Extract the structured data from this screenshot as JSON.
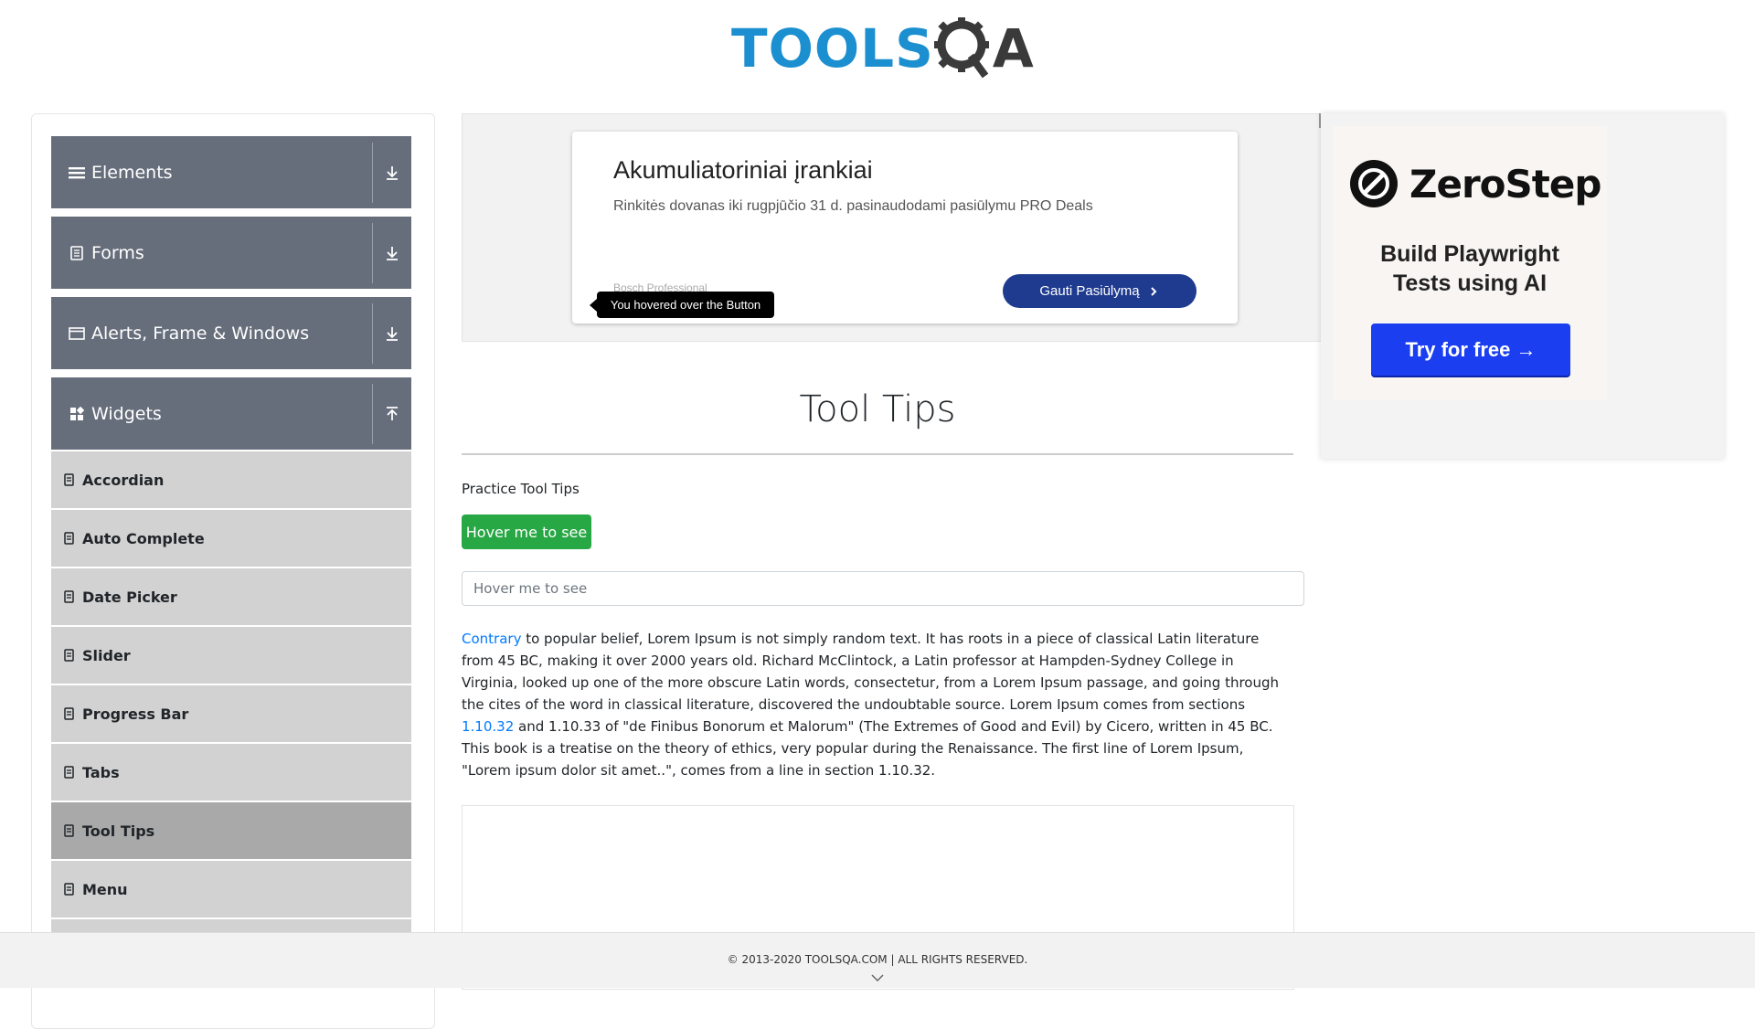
{
  "header": {
    "logo_main": "TOOLS",
    "logo_q": "Q",
    "logo_a": "A"
  },
  "sidebar": {
    "groups": [
      {
        "label": "Elements",
        "icon": "menu-icon"
      },
      {
        "label": "Forms",
        "icon": "form-icon"
      },
      {
        "label": "Alerts, Frame & Windows",
        "icon": "window-icon"
      },
      {
        "label": "Widgets",
        "icon": "widgets-icon"
      }
    ],
    "items": [
      {
        "label": "Accordian"
      },
      {
        "label": "Auto Complete"
      },
      {
        "label": "Date Picker"
      },
      {
        "label": "Slider"
      },
      {
        "label": "Progress Bar"
      },
      {
        "label": "Tabs"
      },
      {
        "label": "Tool Tips",
        "active": true
      },
      {
        "label": "Menu"
      }
    ]
  },
  "ad": {
    "title": "Akumuliatoriniai įrankiai",
    "subtitle": "Rinkitės dovanas iki rugpjūčio 31 d. pasinaudodami pasiūlymu PRO Deals",
    "brand": "Bosch Professional",
    "button": "Gauti Pasiūlymą"
  },
  "tooltip": {
    "text": "You hovered over the Button"
  },
  "main": {
    "title": "Tool Tips",
    "practice_label": "Practice Tool Tips",
    "hover_button": "Hover me to see",
    "hover_input_placeholder": "Hover me to see",
    "paragraph": {
      "link1": "Contrary",
      "part1": " to popular belief, Lorem Ipsum is not simply random text. It has roots in a piece of classical Latin literature from 45 BC, making it over 2000 years old. Richard McClintock, a Latin professor at Hampden-Sydney College in Virginia, looked up one of the more obscure Latin words, consectetur, from a Lorem Ipsum passage, and going through the cites of the word in classical literature, discovered the undoubtable source. Lorem Ipsum comes from sections ",
      "link2": "1.10.32",
      "part2": " and 1.10.33 of \"de Finibus Bonorum et Malorum\" (The Extremes of Good and Evil) by Cicero, written in 45 BC. This book is a treatise on the theory of ethics, very popular during the Renaissance. The first line of Lorem Ipsum, \"Lorem ipsum dolor sit amet..\", comes from a line in section 1.10.32."
    }
  },
  "right_ad": {
    "brand": "ZeroStep",
    "headline_line1": "Build Playwright",
    "headline_line2": "Tests using AI",
    "button": "Try for free →"
  },
  "footer": {
    "text": "© 2013-2020 TOOLSQA.COM | ALL RIGHTS RESERVED."
  },
  "colors": {
    "sidebar_group": "#676e7b",
    "sidebar_item": "#d2d2d2",
    "sidebar_active": "#a9a9a9",
    "green_button": "#28a745",
    "link": "#007bff",
    "zerostep_button": "#1a3ef0"
  }
}
